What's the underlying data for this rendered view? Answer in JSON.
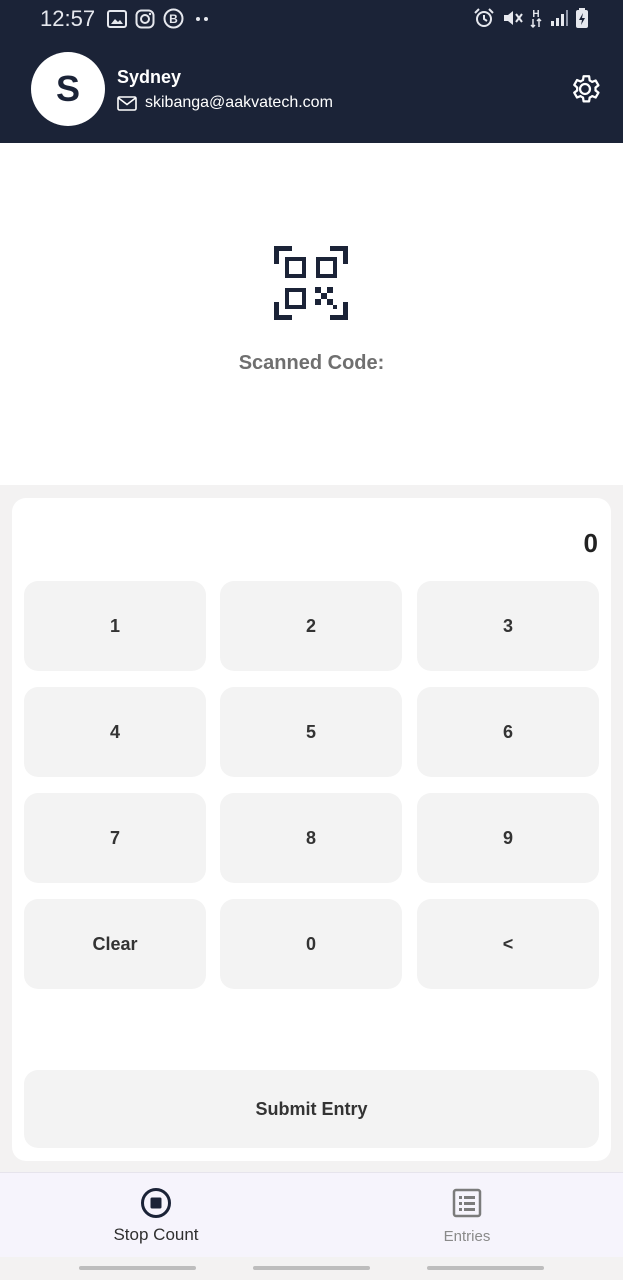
{
  "status_bar": {
    "time": "12:57",
    "left_icons": [
      "image-icon",
      "instagram-icon",
      "b-icon",
      "more-dots-icon"
    ],
    "right_icons": [
      "alarm-icon",
      "mute-icon",
      "network-h-icon",
      "signal-icon",
      "battery-icon"
    ]
  },
  "header": {
    "avatar_initial": "S",
    "user_name": "Sydney",
    "email": "skibanga@aakvatech.com",
    "background_color": "#1b2337"
  },
  "scan": {
    "label": "Scanned Code:"
  },
  "keypad": {
    "display_value": "0",
    "keys": [
      "1",
      "2",
      "3",
      "4",
      "5",
      "6",
      "7",
      "8",
      "9",
      "Clear",
      "0",
      "<"
    ],
    "submit_label": "Submit Entry"
  },
  "bottom_nav": {
    "items": [
      {
        "label": "Stop Count",
        "icon": "stop-circle-icon",
        "active": true
      },
      {
        "label": "Entries",
        "icon": "list-icon",
        "active": false
      }
    ]
  }
}
